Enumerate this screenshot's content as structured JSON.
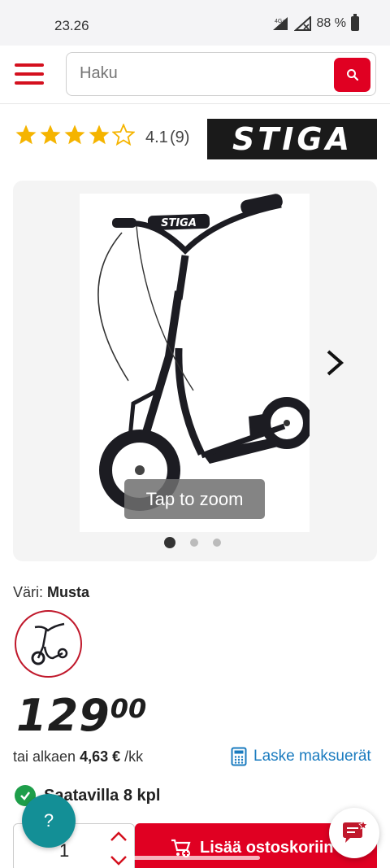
{
  "status_bar": {
    "time": "23.26",
    "network": "4G+",
    "battery": "88 %"
  },
  "header": {
    "menu_icon": "hamburger-menu-icon",
    "search_placeholder": "Haku",
    "search_icon": "search-icon"
  },
  "product": {
    "rating": "4.1",
    "rating_count": "(9)",
    "stars_filled": 4,
    "stars_total": 5,
    "brand": "STIGA",
    "image_overlay": "Tap to zoom",
    "gallery_dots": 3,
    "gallery_active_index": 0,
    "color_label": "Väri:",
    "color_value": "Musta",
    "price_int": "129",
    "price_dec": "00",
    "monthly_prefix": "tai alkaen",
    "monthly_amount": "4,63 €",
    "monthly_suffix": "/kk",
    "calc_link": "Laske maksuerät",
    "availability": "Saatavilla 8 kpl",
    "quantity": "1",
    "add_to_cart": "Lisää ostoskoriin"
  },
  "floating": {
    "help_label": "?",
    "chat_icon": "chat-icon"
  },
  "colors": {
    "brand_red": "#e00022",
    "accent_teal": "#138f96",
    "link_blue": "#1a7bbf",
    "star_gold": "#f5b400",
    "success_green": "#1e9e4a"
  }
}
